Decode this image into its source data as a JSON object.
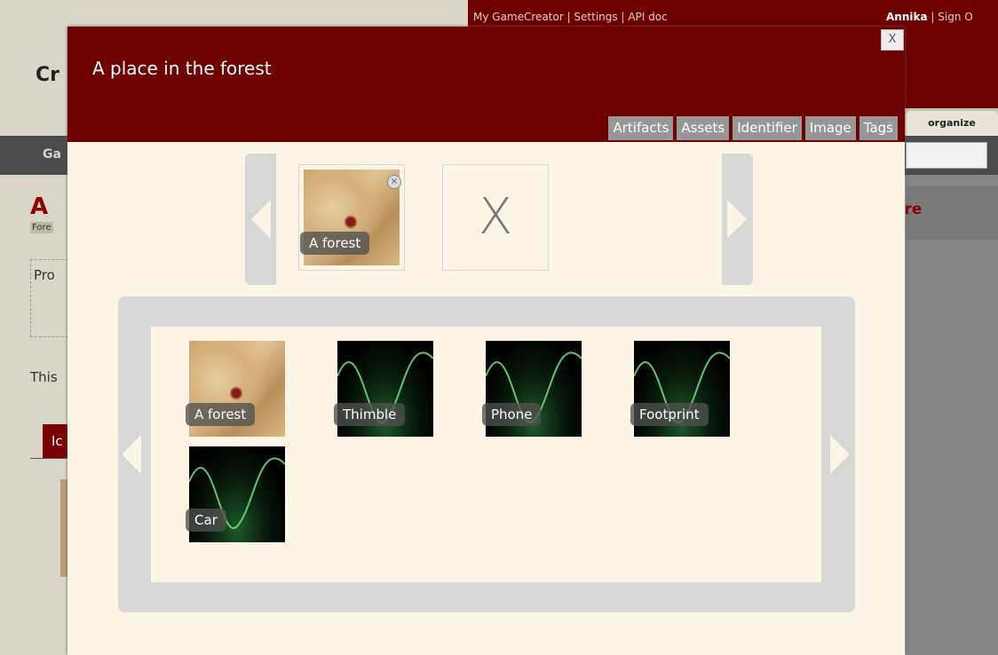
{
  "background": {
    "top_links": "My GameCreator | Settings | API doc",
    "user_name": "Annika",
    "user_links": " | Sign O",
    "logo_fragment": "Cr",
    "organize_label": "organize",
    "nav_fragment": "Ga",
    "heading_fragment": "A",
    "tag_fragment": "Fore",
    "box_fragment": "Pro",
    "text_fragment": "This",
    "tab_fragment": "Ic",
    "right_heading_fragment": "ere"
  },
  "modal": {
    "title": "A place in the forest",
    "close_label": "X",
    "tabs": [
      {
        "label": "Artifacts"
      },
      {
        "label": "Assets"
      },
      {
        "label": "Identifier"
      },
      {
        "label": "Image"
      },
      {
        "label": "Tags"
      }
    ],
    "selected": {
      "items": [
        {
          "label": "A forest",
          "image": "map",
          "remove_label": "×"
        }
      ],
      "empty_slot_label": "X"
    },
    "library": {
      "items": [
        {
          "label": "A forest",
          "image": "map"
        },
        {
          "label": "Thimble",
          "image": "wave"
        },
        {
          "label": "Phone",
          "image": "wave"
        },
        {
          "label": "Footprint",
          "image": "wave"
        },
        {
          "label": "Car",
          "image": "wave"
        }
      ]
    }
  },
  "colors": {
    "header": "#6e0000",
    "modal_bg": "#fcf5e5",
    "tab_bg": "#979797",
    "carousel_frame": "#d7d7d7"
  }
}
